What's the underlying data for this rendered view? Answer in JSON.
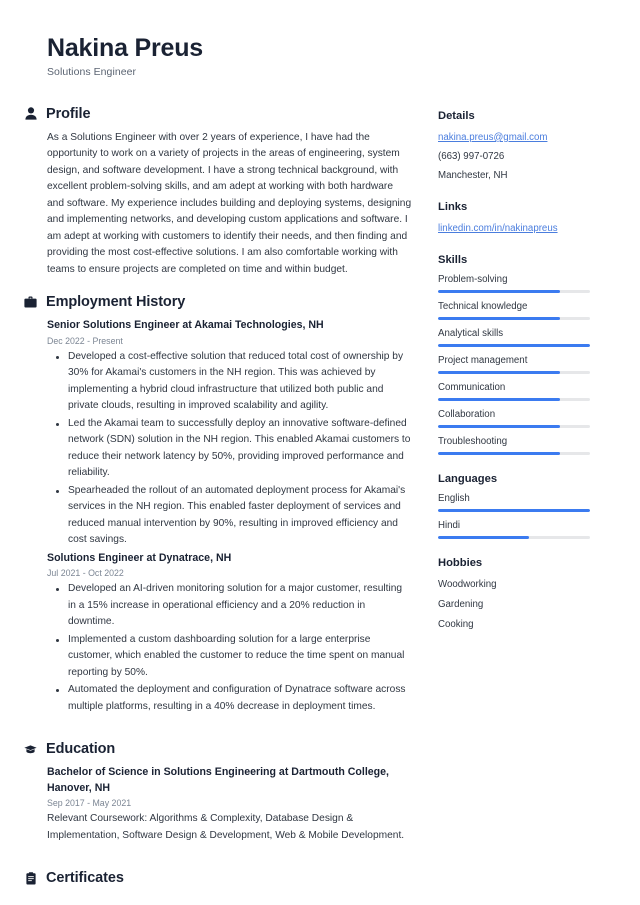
{
  "header": {
    "name": "Nakina Preus",
    "title": "Solutions Engineer"
  },
  "sections": {
    "profile": {
      "icon": "person-icon",
      "title": "Profile",
      "text": "As a Solutions Engineer with over 2 years of experience, I have had the opportunity to work on a variety of projects in the areas of engineering, system design, and software development. I have a strong technical background, with excellent problem-solving skills, and am adept at working with both hardware and software. My experience includes building and deploying systems, designing and implementing networks, and developing custom applications and software. I am adept at working with customers to identify their needs, and then finding and providing the most cost-effective solutions. I am also comfortable working with teams to ensure projects are completed on time and within budget."
    },
    "employment": {
      "icon": "briefcase-icon",
      "title": "Employment History",
      "entries": [
        {
          "title": "Senior Solutions Engineer at Akamai Technologies, NH",
          "date": "Dec 2022 - Present",
          "bullets": [
            "Developed a cost-effective solution that reduced total cost of ownership by 30% for Akamai's customers in the NH region. This was achieved by implementing a hybrid cloud infrastructure that utilized both public and private clouds, resulting in improved scalability and agility.",
            "Led the Akamai team to successfully deploy an innovative software-defined network (SDN) solution in the NH region. This enabled Akamai customers to reduce their network latency by 50%, providing improved performance and reliability.",
            "Spearheaded the rollout of an automated deployment process for Akamai's services in the NH region. This enabled faster deployment of services and reduced manual intervention by 90%, resulting in improved efficiency and cost savings."
          ]
        },
        {
          "title": "Solutions Engineer at Dynatrace, NH",
          "date": "Jul 2021 - Oct 2022",
          "bullets": [
            "Developed an AI-driven monitoring solution for a major customer, resulting in a 15% increase in operational efficiency and a 20% reduction in downtime.",
            "Implemented a custom dashboarding solution for a large enterprise customer, which enabled the customer to reduce the time spent on manual reporting by 50%.",
            "Automated the deployment and configuration of Dynatrace software across multiple platforms, resulting in a 40% decrease in deployment times."
          ]
        }
      ]
    },
    "education": {
      "icon": "graduation-cap-icon",
      "title": "Education",
      "entries": [
        {
          "title": "Bachelor of Science in Solutions Engineering at Dartmouth College, Hanover, NH",
          "date": "Sep 2017 - May 2021",
          "description": "Relevant Coursework: Algorithms & Complexity, Database Design & Implementation, Software Design & Development, Web & Mobile Development."
        }
      ]
    },
    "certificates": {
      "icon": "clipboard-icon",
      "title": "Certificates"
    }
  },
  "sidebar": {
    "details": {
      "title": "Details",
      "email": "nakina.preus@gmail.com",
      "phone": "(663) 997-0726",
      "location": "Manchester, NH"
    },
    "links": {
      "title": "Links",
      "items": [
        {
          "label": "linkedin.com/in/nakinapreus"
        }
      ]
    },
    "skills": {
      "title": "Skills",
      "items": [
        {
          "label": "Problem-solving",
          "level": 80
        },
        {
          "label": "Technical knowledge",
          "level": 80
        },
        {
          "label": "Analytical skills",
          "level": 100
        },
        {
          "label": "Project management",
          "level": 80
        },
        {
          "label": "Communication",
          "level": 80
        },
        {
          "label": "Collaboration",
          "level": 80
        },
        {
          "label": "Troubleshooting",
          "level": 80
        }
      ]
    },
    "languages": {
      "title": "Languages",
      "items": [
        {
          "label": "English",
          "level": 100
        },
        {
          "label": "Hindi",
          "level": 60
        }
      ]
    },
    "hobbies": {
      "title": "Hobbies",
      "items": [
        {
          "label": "Woodworking"
        },
        {
          "label": "Gardening"
        },
        {
          "label": "Cooking"
        }
      ]
    }
  },
  "colors": {
    "accent": "#3b7bf0",
    "link": "#4a7dde",
    "heading": "#1a2233",
    "body": "#303742",
    "muted": "#7c8694",
    "track": "#e6e7e9"
  }
}
